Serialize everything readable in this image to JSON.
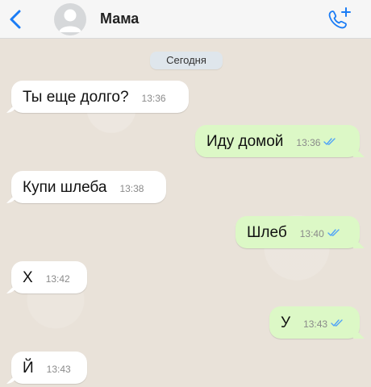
{
  "header": {
    "contact_name": "Мама",
    "back_icon": "chevron-left-icon",
    "call_icon": "add-call-icon",
    "accent_color": "#1a7cf5"
  },
  "chat": {
    "date_label": "Сегодня",
    "messages": [
      {
        "direction": "in",
        "text": "Ты еще долго?",
        "time": "13:36"
      },
      {
        "direction": "out",
        "text": "Иду домой",
        "time": "13:36",
        "status": "read"
      },
      {
        "direction": "in",
        "text": "Купи шлеба",
        "time": "13:38"
      },
      {
        "direction": "out",
        "text": "Шлеб",
        "time": "13:40",
        "status": "read"
      },
      {
        "direction": "in",
        "text": "Х",
        "time": "13:42"
      },
      {
        "direction": "out",
        "text": "У",
        "time": "13:43",
        "status": "read"
      },
      {
        "direction": "in",
        "text": "Й",
        "time": "13:43"
      }
    ]
  }
}
